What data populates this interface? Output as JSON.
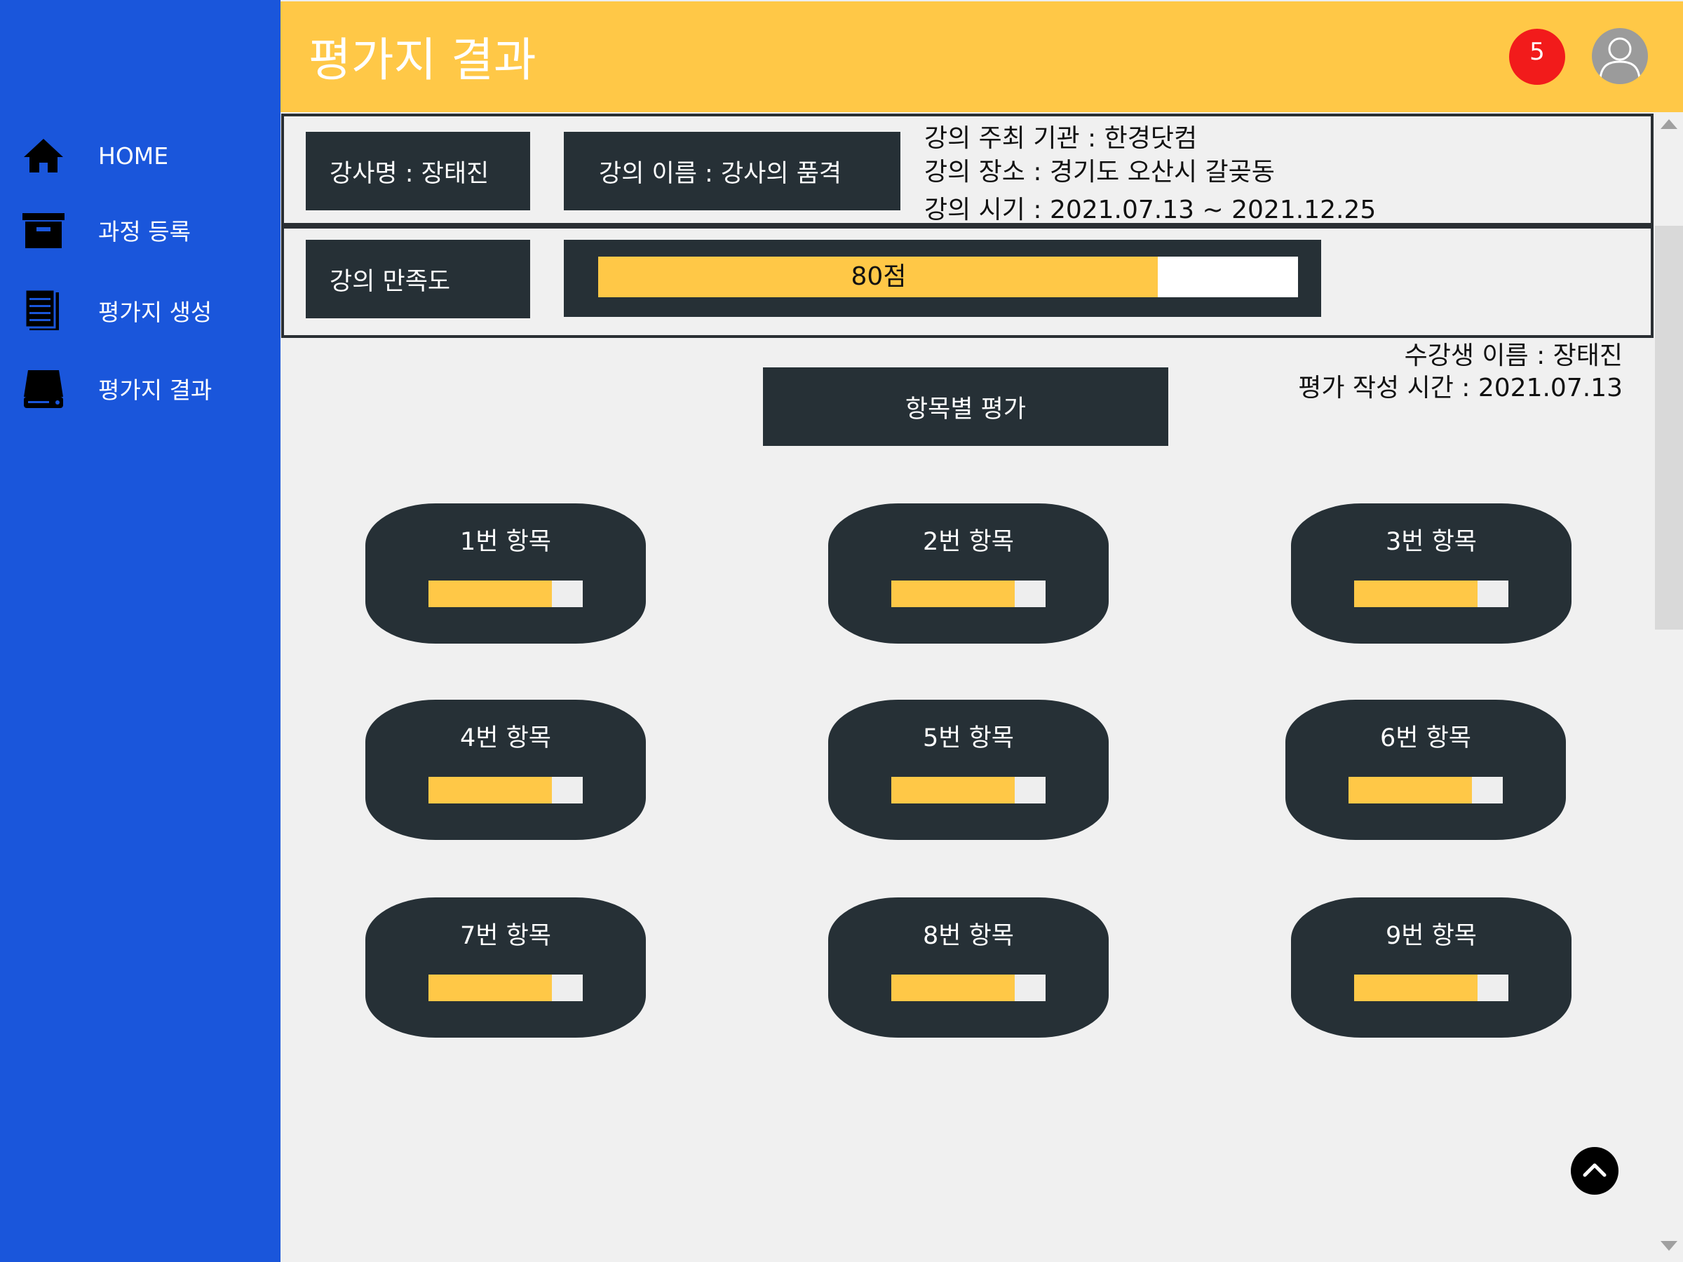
{
  "header": {
    "title": "평가지 결과",
    "notification_count": "5"
  },
  "sidebar": {
    "items": [
      {
        "label": "HOME",
        "icon": "home-icon"
      },
      {
        "label": "과정 등록",
        "icon": "archive-box-icon"
      },
      {
        "label": "평가지 생성",
        "icon": "document-icon"
      },
      {
        "label": "평가지 결과",
        "icon": "drive-icon"
      }
    ]
  },
  "lecture": {
    "instructor": "강사명 : 장태진",
    "name": "강의 이름 : 강사의 품격",
    "host": "강의 주최 기관 : 한경닷컴",
    "location": "강의 장소 : 경기도 오산시 갈곶동",
    "period": "강의 시기 : 2021.07.13 ~ 2021.12.25"
  },
  "satisfaction": {
    "label": "강의 만족도",
    "score_text": "80점",
    "score": 80
  },
  "student": {
    "name": "수강생 이름 : 장태진",
    "written_time": "평가 작성 시간 : 2021.07.13"
  },
  "section_title": "항목별 평가",
  "items": [
    {
      "label": "1번 항목",
      "score": 80
    },
    {
      "label": "2번 항목",
      "score": 80
    },
    {
      "label": "3번 항목",
      "score": 80
    },
    {
      "label": "4번 항목",
      "score": 80
    },
    {
      "label": "5번 항목",
      "score": 80
    },
    {
      "label": "6번 항목",
      "score": 80
    },
    {
      "label": "7번 항목",
      "score": 80
    },
    {
      "label": "8번 항목",
      "score": 80
    },
    {
      "label": "9번 항목",
      "score": 80
    }
  ],
  "colors": {
    "sidebar": "#1a56db",
    "header": "#ffc847",
    "dark": "#263036",
    "accent": "#ffc847",
    "badge": "#f21b1b"
  }
}
